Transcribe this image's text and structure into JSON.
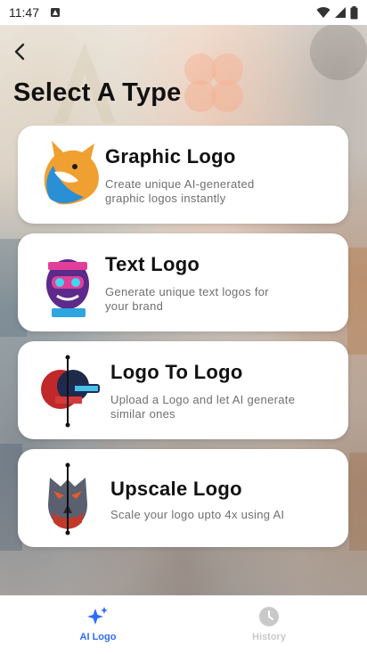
{
  "status_bar": {
    "time": "11:47"
  },
  "header": {
    "title": "Select A Type"
  },
  "cards": [
    {
      "title": "Graphic Logo",
      "description": "Create unique AI-generated graphic logos instantly"
    },
    {
      "title": "Text Logo",
      "description": "Generate unique text logos for your brand"
    },
    {
      "title": "Logo To Logo",
      "description": "Upload a Logo and let AI generate similar ones"
    },
    {
      "title": "Upscale Logo",
      "description": "Scale your logo upto 4x using AI"
    }
  ],
  "bottom_nav": {
    "items": [
      {
        "label": "AI Logo",
        "icon": "sparkle-icon",
        "active": true
      },
      {
        "label": "History",
        "icon": "clock-icon",
        "active": false
      }
    ]
  },
  "colors": {
    "accent": "#2f6bff",
    "inactive": "#c9c9c9"
  }
}
